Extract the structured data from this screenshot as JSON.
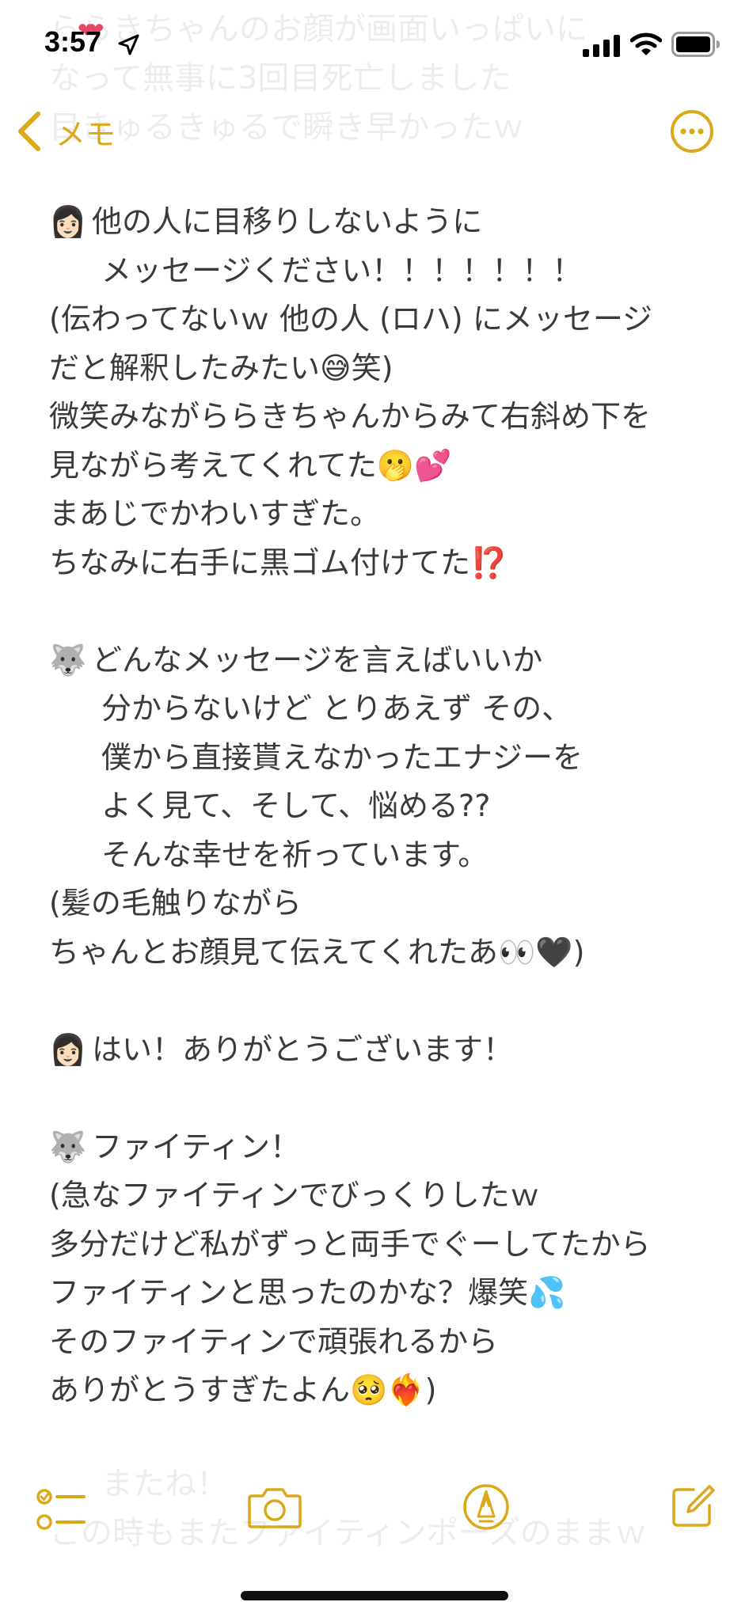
{
  "status_bar": {
    "time": "3:57",
    "hearts": "❤❤"
  },
  "nav": {
    "back_label": "メモ"
  },
  "ghost_top": [
    "ららきちゃんのお顔が画面いっぱいに",
    "なって無事に3回目死亡しました",
    "目きゅるきゅるで瞬き早かったｗ"
  ],
  "ghost_bottom": [
    "またね！",
    "この時もまたファイティンポーズのままｗ"
  ],
  "note": {
    "lines": [
      {
        "avatar": "👩🏻",
        "text": "他の人に目移りしないように",
        "indent": false
      },
      {
        "avatar": "",
        "text": "メッセージください！！！！！！！",
        "indent": true
      },
      {
        "avatar": "",
        "text": "(伝わってないｗ 他の人 (ロハ) にメッセージ",
        "indent": false
      },
      {
        "avatar": "",
        "text": "だと解釈したみたい😅笑)",
        "indent": false
      },
      {
        "avatar": "",
        "text": "微笑みながららきちゃんからみて右斜め下を",
        "indent": false
      },
      {
        "avatar": "",
        "text": "見ながら考えてくれてた🫢💕",
        "indent": false
      },
      {
        "avatar": "",
        "text": "まあじでかわいすぎた。",
        "indent": false
      },
      {
        "avatar": "",
        "text": "ちなみに右手に黒ゴム付けてた⁉️",
        "indent": false
      },
      {
        "avatar": "",
        "text": "",
        "indent": false
      },
      {
        "avatar": "🐺",
        "text": "どんなメッセージを言えばいいか",
        "indent": false
      },
      {
        "avatar": "",
        "text": "分からないけど とりあえず その、",
        "indent": true
      },
      {
        "avatar": "",
        "text": "僕から直接貰えなかったエナジーを",
        "indent": true
      },
      {
        "avatar": "",
        "text": "よく見て、そして、悩める??",
        "indent": true
      },
      {
        "avatar": "",
        "text": "そんな幸せを祈っています。",
        "indent": true
      },
      {
        "avatar": "",
        "text": "(髪の毛触りながら",
        "indent": false
      },
      {
        "avatar": "",
        "text": "ちゃんとお顔見て伝えてくれたあ👀🖤)",
        "indent": false
      },
      {
        "avatar": "",
        "text": "",
        "indent": false
      },
      {
        "avatar": "👩🏻",
        "text": "はい！ありがとうございます！",
        "indent": false
      },
      {
        "avatar": "",
        "text": "",
        "indent": false
      },
      {
        "avatar": "🐺",
        "text": "ファイティン！",
        "indent": false
      },
      {
        "avatar": "",
        "text": "(急なファイティンでびっくりしたｗ",
        "indent": false
      },
      {
        "avatar": "",
        "text": "多分だけど私がずっと両手でぐーしてたから",
        "indent": false
      },
      {
        "avatar": "",
        "text": "ファイティンと思ったのかな？爆笑💦",
        "indent": false
      },
      {
        "avatar": "",
        "text": "そのファイティンで頑張れるから",
        "indent": false
      },
      {
        "avatar": "",
        "text": "ありがとうすぎたよん🥺❤️‍🔥)",
        "indent": false
      }
    ]
  },
  "colors": {
    "accent": "#dba818",
    "text": "#3a3a3c",
    "background": "#ffffff"
  },
  "icons": {
    "back": "chevron-left-icon",
    "more": "ellipsis-circle-icon",
    "checklist": "checklist-icon",
    "camera": "camera-icon",
    "markup": "markup-pen-icon",
    "compose": "compose-icon"
  }
}
